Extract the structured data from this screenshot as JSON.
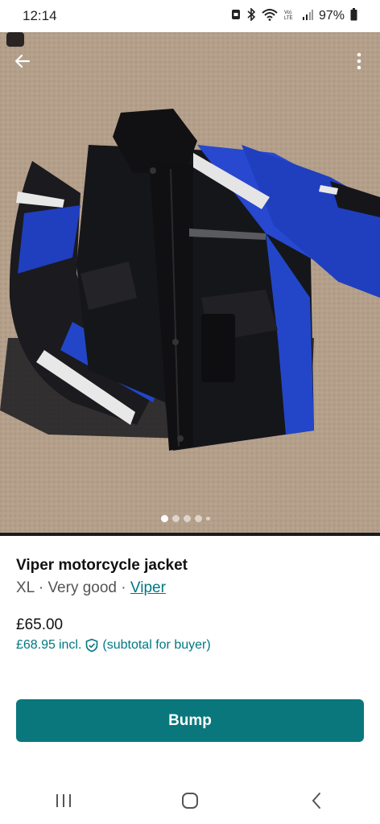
{
  "status": {
    "time": "12:14",
    "battery_text": "97%",
    "icons": [
      "data-saver-icon",
      "bluetooth-icon",
      "wifi-icon",
      "volte-icon",
      "signal-icon",
      "battery-icon"
    ]
  },
  "listing": {
    "title": "Viper motorcycle jacket",
    "size": "XL",
    "separator": " · ",
    "condition": "Very good",
    "brand": "Viper",
    "price": "£65.00",
    "buyer_price": "£68.95",
    "incl_label": "incl.",
    "subtotal_note": "(subtotal for buyer)"
  },
  "carousel": {
    "count": 5,
    "active_index": 0
  },
  "actions": {
    "bump_label": "Bump"
  },
  "colors": {
    "accent": "#09777c",
    "link": "#007782"
  }
}
